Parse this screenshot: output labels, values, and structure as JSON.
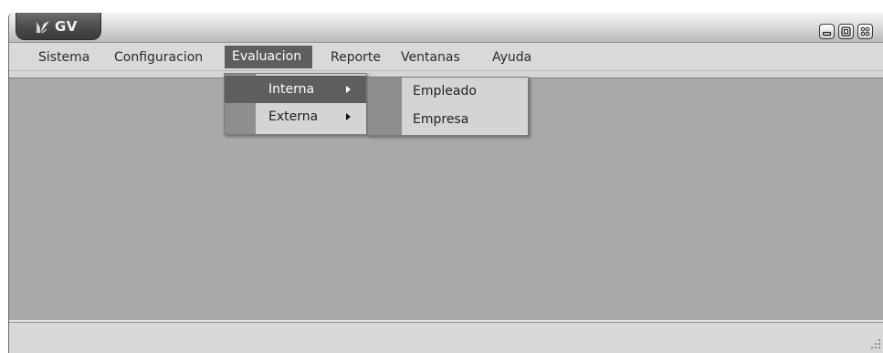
{
  "app": {
    "title": "GV",
    "icon": "app-logo-icon"
  },
  "window_controls": {
    "minimize": "minimize-icon",
    "maximize": "maximize-icon",
    "close": "close-icon"
  },
  "menubar": {
    "items": [
      {
        "label": "Sistema"
      },
      {
        "label": "Configuracion"
      },
      {
        "label": "Evaluacion",
        "active": true
      },
      {
        "label": "Reporte"
      },
      {
        "label": "Ventanas"
      },
      {
        "label": "Ayuda"
      }
    ]
  },
  "evaluacion_menu": {
    "items": [
      {
        "label": "Interna",
        "has_submenu": true,
        "highlighted": true
      },
      {
        "label": "Externa",
        "has_submenu": true,
        "highlighted": false
      }
    ]
  },
  "interna_submenu": {
    "items": [
      {
        "label": "Empleado"
      },
      {
        "label": "Empresa"
      }
    ]
  },
  "colors": {
    "workspace": "#a9a9a9",
    "menu_highlight": "#5e5e5e",
    "menu_gutter": "#8e8e8e"
  }
}
